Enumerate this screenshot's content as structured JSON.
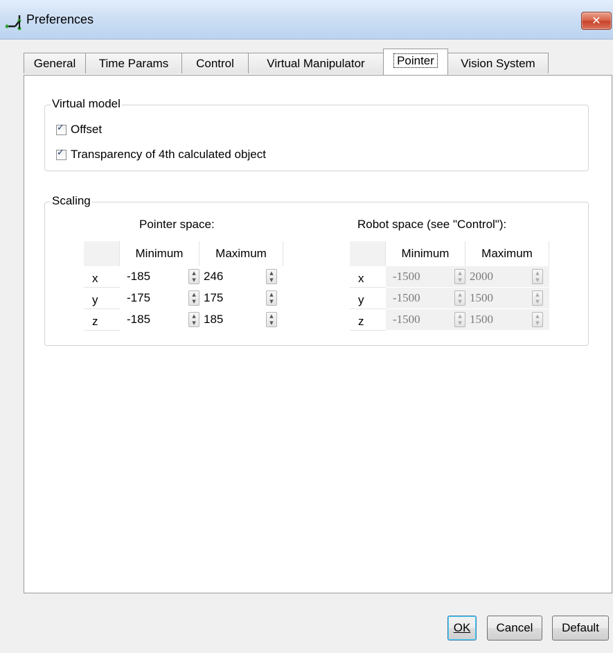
{
  "window": {
    "title": "Preferences",
    "close_label": "✕"
  },
  "tabs": [
    {
      "label": "General"
    },
    {
      "label": "Time Params"
    },
    {
      "label": "Control"
    },
    {
      "label": "Virtual Manipulator"
    },
    {
      "label": "Pointer"
    },
    {
      "label": "Vision System"
    }
  ],
  "active_tab": "Pointer",
  "virtual_model": {
    "title": "Virtual model",
    "offset_label": "Offset",
    "offset_checked": true,
    "transparency_label": "Transparency of 4th calculated object",
    "transparency_checked": true
  },
  "scaling": {
    "title": "Scaling",
    "pointer_space": {
      "title": "Pointer space:",
      "col_min": "Minimum",
      "col_max": "Maximum",
      "rows": [
        {
          "axis": "x",
          "min": "-185",
          "max": "246"
        },
        {
          "axis": "y",
          "min": "-175",
          "max": "175"
        },
        {
          "axis": "z",
          "min": "-185",
          "max": "185"
        }
      ]
    },
    "robot_space": {
      "title": "Robot space (see \"Control\"):",
      "col_min": "Minimum",
      "col_max": "Maximum",
      "rows": [
        {
          "axis": "x",
          "min": "-1500",
          "max": "2000"
        },
        {
          "axis": "y",
          "min": "-1500",
          "max": "1500"
        },
        {
          "axis": "z",
          "min": "-1500",
          "max": "1500"
        }
      ]
    }
  },
  "buttons": {
    "ok": "OK",
    "cancel": "Cancel",
    "default": "Default"
  },
  "colors": {
    "titlebar": "#c9dcf3",
    "close": "#c8432c",
    "window": "#f0f0f0"
  }
}
